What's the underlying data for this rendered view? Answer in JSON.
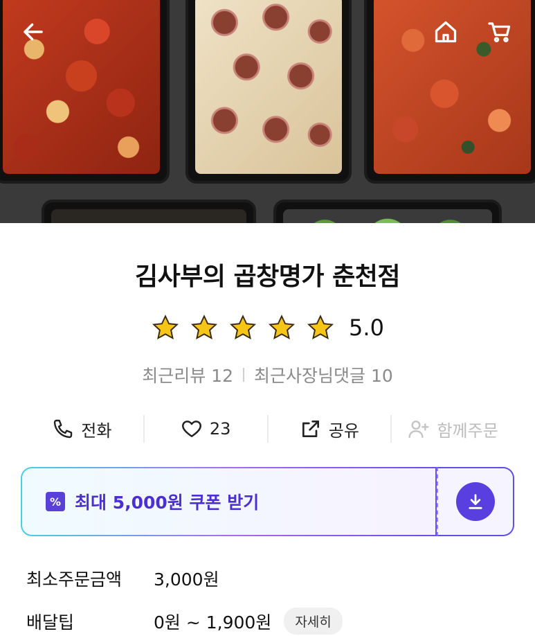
{
  "hero": {
    "back_icon": "arrow-left-icon",
    "home_icon": "home-icon",
    "cart_icon": "cart-icon"
  },
  "store": {
    "name": "김사부의 곱창명가 춘천점",
    "rating_value": "5.0",
    "rating_stars": 5,
    "recent_reviews": "최근리뷰 12",
    "recent_owner_replies": "최근사장님댓글 10"
  },
  "actions": {
    "call_label": "전화",
    "like_count": "23",
    "share_label": "공유",
    "group_order_label": "함께주문"
  },
  "coupon": {
    "text": "최대 5,000원 쿠폰 받기",
    "icon": "download-icon"
  },
  "info": {
    "min_order_label": "최소주문금액",
    "min_order_value": "3,000원",
    "delivery_tip_label": "배달팁",
    "delivery_tip_value": "0원 ~ 1,900원",
    "detail_button": "자세히"
  },
  "colors": {
    "star": "#f5c518",
    "accent": "#5a3fe0",
    "muted_text": "#8a8a8a"
  }
}
